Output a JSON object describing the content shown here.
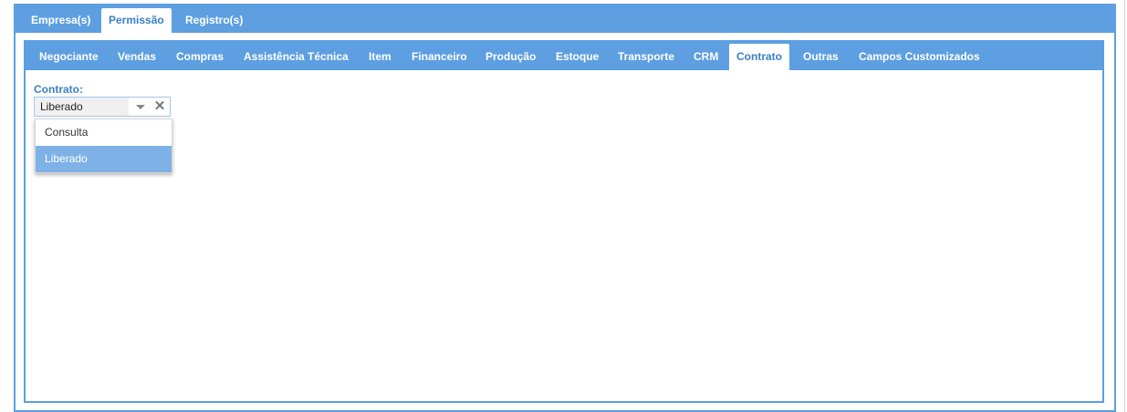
{
  "outer_tabs": [
    {
      "label": "Empresa(s)",
      "active": false
    },
    {
      "label": "Permissão",
      "active": true
    },
    {
      "label": "Registro(s)",
      "active": false
    }
  ],
  "inner_tabs": [
    {
      "label": "Negociante"
    },
    {
      "label": "Vendas"
    },
    {
      "label": "Compras"
    },
    {
      "label": "Assistência Técnica"
    },
    {
      "label": "Item"
    },
    {
      "label": "Financeiro"
    },
    {
      "label": "Produção"
    },
    {
      "label": "Estoque"
    },
    {
      "label": "Transporte"
    },
    {
      "label": "CRM"
    },
    {
      "label": "Contrato",
      "active": true
    },
    {
      "label": "Outras"
    },
    {
      "label": "Campos Customizados"
    }
  ],
  "field": {
    "label": "Contrato:",
    "value": "Liberado",
    "options": [
      "Consulta",
      "Liberado"
    ],
    "selected": "Liberado"
  },
  "colors": {
    "accent": "#5d9fe0",
    "selected_option": "#7eb2e6",
    "active_tab_text": "#3b7fc4"
  },
  "icons": {
    "dropdown": "caret-down-icon",
    "clear": "clear-x-icon"
  }
}
